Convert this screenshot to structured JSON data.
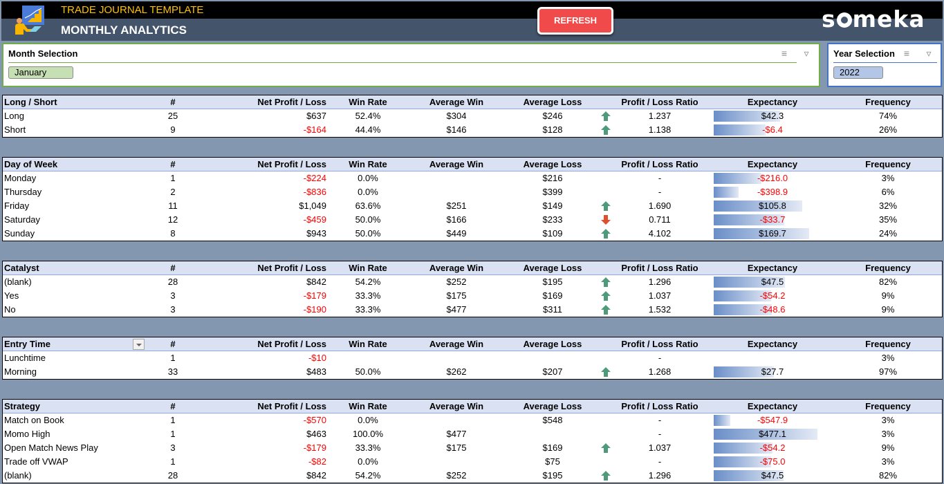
{
  "header": {
    "subtitle": "TRADE JOURNAL TEMPLATE",
    "title": "MONTHLY ANALYTICS",
    "refresh_label": "REFRESH",
    "brand": [
      "s",
      "meka"
    ]
  },
  "slicers": {
    "month": {
      "title": "Month Selection",
      "selected": "January"
    },
    "year": {
      "title": "Year Selection",
      "selected": "2022"
    }
  },
  "columns": [
    "#",
    "Net Profit / Loss",
    "Win Rate",
    "Average Win",
    "Average Loss",
    "Profit / Loss Ratio",
    "Expectancy",
    "Frequency"
  ],
  "tables": [
    {
      "title": "Long / Short",
      "rows": [
        {
          "name": "Long",
          "count": "25",
          "net": "$637",
          "net_neg": false,
          "win_rate": "52.4%",
          "avg_win": "$304",
          "avg_loss": "$246",
          "arrow": "up",
          "ratio": "1.237",
          "exp": "$42.3",
          "exp_neg": false,
          "exp_bar": 0.64,
          "freq": "74%"
        },
        {
          "name": "Short",
          "count": "9",
          "net": "-$164",
          "net_neg": true,
          "win_rate": "44.4%",
          "avg_win": "$146",
          "avg_loss": "$128",
          "arrow": "up",
          "ratio": "1.138",
          "exp": "-$6.4",
          "exp_neg": true,
          "exp_bar": 0.5,
          "freq": "26%"
        }
      ]
    },
    {
      "title": "Day of Week",
      "rows": [
        {
          "name": "Monday",
          "count": "1",
          "net": "-$224",
          "net_neg": true,
          "win_rate": "0.0%",
          "avg_win": "",
          "avg_loss": "$216",
          "arrow": "",
          "ratio": "-",
          "exp": "-$216.0",
          "exp_neg": true,
          "exp_bar": 0.46,
          "freq": "3%"
        },
        {
          "name": "Thursday",
          "count": "2",
          "net": "-$836",
          "net_neg": true,
          "win_rate": "0.0%",
          "avg_win": "",
          "avg_loss": "$399",
          "arrow": "",
          "ratio": "-",
          "exp": "-$398.9",
          "exp_neg": true,
          "exp_bar": 0.24,
          "freq": "6%"
        },
        {
          "name": "Friday",
          "count": "11",
          "net": "$1,049",
          "net_neg": false,
          "win_rate": "63.6%",
          "avg_win": "$251",
          "avg_loss": "$149",
          "arrow": "up",
          "ratio": "1.690",
          "exp": "$105.8",
          "exp_neg": false,
          "exp_bar": 0.85,
          "freq": "32%"
        },
        {
          "name": "Saturday",
          "count": "12",
          "net": "-$459",
          "net_neg": true,
          "win_rate": "50.0%",
          "avg_win": "$166",
          "avg_loss": "$233",
          "arrow": "down",
          "ratio": "0.711",
          "exp": "-$33.7",
          "exp_neg": true,
          "exp_bar": 0.68,
          "freq": "35%"
        },
        {
          "name": "Sunday",
          "count": "8",
          "net": "$943",
          "net_neg": false,
          "win_rate": "50.0%",
          "avg_win": "$449",
          "avg_loss": "$109",
          "arrow": "up",
          "ratio": "4.102",
          "exp": "$169.7",
          "exp_neg": false,
          "exp_bar": 0.92,
          "freq": "24%"
        }
      ]
    },
    {
      "title": "Catalyst",
      "rows": [
        {
          "name": "(blank)",
          "count": "28",
          "net": "$842",
          "net_neg": false,
          "win_rate": "54.2%",
          "avg_win": "$252",
          "avg_loss": "$195",
          "arrow": "up",
          "ratio": "1.296",
          "exp": "$47.5",
          "exp_neg": false,
          "exp_bar": 0.69,
          "freq": "82%"
        },
        {
          "name": "Yes",
          "count": "3",
          "net": "-$179",
          "net_neg": true,
          "win_rate": "33.3%",
          "avg_win": "$175",
          "avg_loss": "$169",
          "arrow": "up",
          "ratio": "1.037",
          "exp": "-$54.2",
          "exp_neg": true,
          "exp_bar": 0.55,
          "freq": "9%"
        },
        {
          "name": "No",
          "count": "3",
          "net": "-$190",
          "net_neg": true,
          "win_rate": "33.3%",
          "avg_win": "$477",
          "avg_loss": "$311",
          "arrow": "up",
          "ratio": "1.532",
          "exp": "-$48.6",
          "exp_neg": true,
          "exp_bar": 0.56,
          "freq": "9%"
        }
      ]
    },
    {
      "title": "Entry Time",
      "has_filter": true,
      "rows": [
        {
          "name": "Lunchtime",
          "count": "1",
          "net": "-$10",
          "net_neg": true,
          "win_rate": "",
          "avg_win": "",
          "avg_loss": "",
          "arrow": "",
          "ratio": "-",
          "exp": "",
          "exp_neg": false,
          "exp_bar": 0,
          "freq": "3%"
        },
        {
          "name": "Morning",
          "count": "33",
          "net": "$483",
          "net_neg": false,
          "win_rate": "50.0%",
          "avg_win": "$262",
          "avg_loss": "$207",
          "arrow": "up",
          "ratio": "1.268",
          "exp": "$27.7",
          "exp_neg": false,
          "exp_bar": 0.58,
          "freq": "97%"
        }
      ]
    },
    {
      "title": "Strategy",
      "rows": [
        {
          "name": "Match on Book",
          "count": "1",
          "net": "-$570",
          "net_neg": true,
          "win_rate": "0.0%",
          "avg_win": "",
          "avg_loss": "$548",
          "arrow": "",
          "ratio": "-",
          "exp": "-$547.9",
          "exp_neg": true,
          "exp_bar": 0.16,
          "freq": "3%"
        },
        {
          "name": "Momo High",
          "count": "1",
          "net": "$463",
          "net_neg": false,
          "win_rate": "100.0%",
          "avg_win": "$477",
          "avg_loss": "",
          "arrow": "",
          "ratio": "-",
          "exp": "$477.1",
          "exp_neg": false,
          "exp_bar": 1.0,
          "freq": "3%"
        },
        {
          "name": "Open Match News Play",
          "count": "3",
          "net": "-$179",
          "net_neg": true,
          "win_rate": "33.3%",
          "avg_win": "$175",
          "avg_loss": "$169",
          "arrow": "up",
          "ratio": "1.037",
          "exp": "-$54.2",
          "exp_neg": true,
          "exp_bar": 0.57,
          "freq": "9%"
        },
        {
          "name": "Trade off VWAP",
          "count": "1",
          "net": "-$82",
          "net_neg": true,
          "win_rate": "0.0%",
          "avg_win": "",
          "avg_loss": "$75",
          "arrow": "",
          "ratio": "-",
          "exp": "-$75.0",
          "exp_neg": true,
          "exp_bar": 0.55,
          "freq": "3%"
        },
        {
          "name": "(blank)",
          "count": "28",
          "net": "$842",
          "net_neg": false,
          "win_rate": "54.2%",
          "avg_win": "$252",
          "avg_loss": "$195",
          "arrow": "up",
          "ratio": "1.296",
          "exp": "$47.5",
          "exp_neg": false,
          "exp_bar": 0.67,
          "freq": "82%"
        }
      ]
    }
  ],
  "colors": {
    "negative": "#ff0000",
    "arrow_up": "#4e9a7a",
    "arrow_down": "#e0502d",
    "accent_month": "#70ad47",
    "accent_year": "#4472c4"
  }
}
